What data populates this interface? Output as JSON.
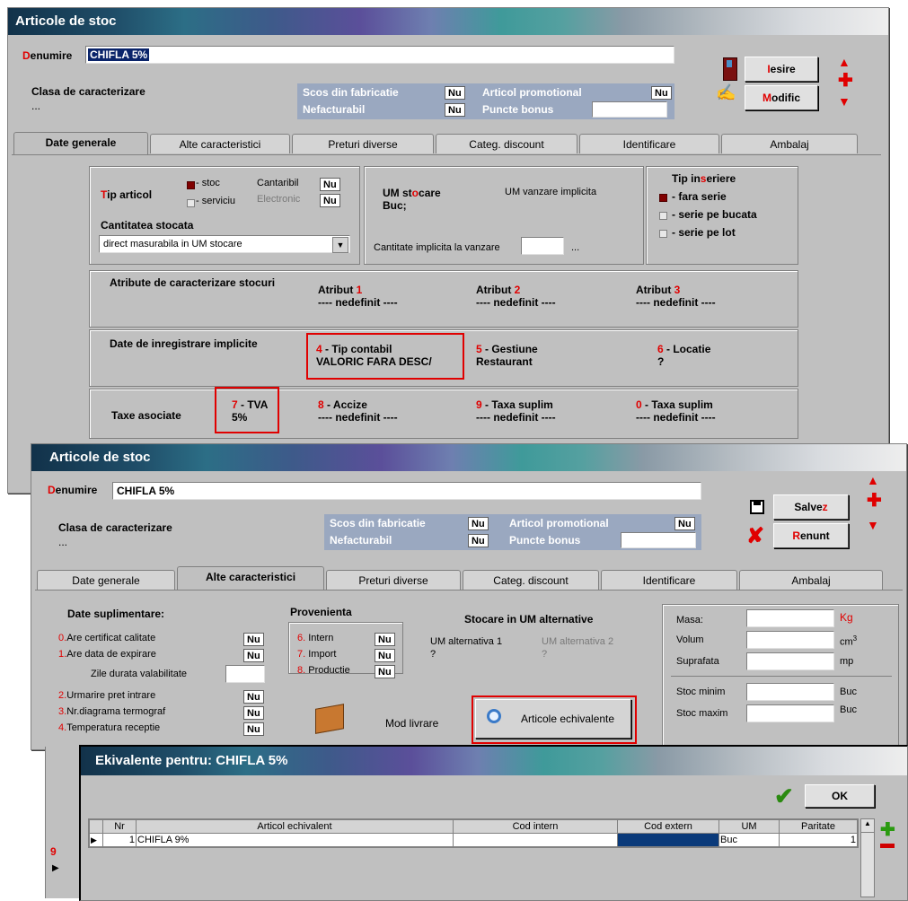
{
  "w1": {
    "title": "Articole de stoc",
    "denumire_label_first": "D",
    "denumire_label_rest": "enumire",
    "denumire_value": "CHIFLA 5%",
    "clasa_label_first": "Cl",
    "clasa_label_rest": "asa de caracterizare",
    "clasa_value": "...",
    "scos_label": "Scos din fabricatie",
    "scos_value": "Nu",
    "nefacturabil_label": "Nefacturabil",
    "nefacturabil_value": "Nu",
    "promo_label": "Articol promotional",
    "promo_value": "Nu",
    "bonus_label": "Puncte bonus",
    "btn_iesire_a": "I",
    "btn_iesire_b": "esire",
    "btn_modific_a": "M",
    "btn_modific_b": "odific",
    "tabs": [
      "Date generale",
      "Alte caracteristici",
      "Preturi diverse",
      "Categ. discount",
      "Identificare",
      "Ambalaj"
    ],
    "tip_articol_a": "T",
    "tip_articol_b": "ip articol",
    "stoc": "- stoc",
    "serviciu": "- serviciu",
    "cantaribil": "Cantaribil",
    "cantaribil_value": "Nu",
    "electronic": "Electronic",
    "electronic_value": "Nu",
    "cant_stocata": "Cantitatea stocata",
    "cant_stocata_value": "direct masurabila in UM stocare",
    "um_stocare_a": "UM st",
    "um_stocare_b": "o",
    "um_stocare_c": "care",
    "um_stocare_value": "Buc;",
    "um_vanzare": "UM vanzare implicita",
    "cant_vanzare": "Cantitate implicita la vanzare",
    "ellipsis": "...",
    "tip_inseriere_a": "Tip in",
    "tip_inseriere_b": "s",
    "tip_inseriere_c": "eriere",
    "fara_serie": "- fara serie",
    "serie_bucata": "- serie pe bucata",
    "serie_lot": "- serie pe lot",
    "atribute": "Atribute de caracterizare stocuri",
    "atribut1_a": "Atribut ",
    "atribut1_b": "1",
    "atribut2_b": "2",
    "atribut3_b": "3",
    "nedefinit": "---- nedefinit ----",
    "date_inreg": "Date de inregistrare implicite",
    "tip_contabil_a": "4",
    "tip_contabil_b": " - Tip contabil",
    "tip_contabil_value": "VALORIC FARA DESC/",
    "gestiune_a": "5",
    "gestiune_b": " - Gestiune",
    "gestiune_value": "Restaurant",
    "locatie_a": "6",
    "locatie_b": " - Locatie",
    "locatie_value": "?",
    "taxe": "Taxe asociate",
    "tva_a": "7",
    "tva_b": " - TVA",
    "tva_value": "5%",
    "accize_a": "8",
    "accize_b": " - Accize",
    "taxa9_a": "9",
    "taxa9_b": " - Taxa suplim",
    "taxa0_a": "0",
    "taxa0_b": " - Taxa suplim"
  },
  "w2": {
    "title": "Articole de stoc",
    "denumire_value": "CHIFLA 5%",
    "clasa_value": "...",
    "btn_salvez_a": "Salve",
    "btn_salvez_b": "z",
    "btn_renunt_a": "R",
    "btn_renunt_b": "enunt",
    "date_supl": "Date suplimentare:",
    "supl_items": [
      {
        "k": "0.",
        "t": "Are certificat calitate",
        "v": "Nu"
      },
      {
        "k": "1.",
        "t": "Are data de expirare",
        "v": "Nu"
      },
      {
        "k": "",
        "t": "Zile durata valabilitate",
        "v": ""
      },
      {
        "k": "2.",
        "t": "Urmarire pret intrare",
        "v": "Nu"
      },
      {
        "k": "3.",
        "t": "Nr.diagrama termograf",
        "v": "Nu"
      },
      {
        "k": "4.",
        "t": "Temperatura receptie",
        "v": "Nu"
      }
    ],
    "provenienta": "Provenienta",
    "prov_items": [
      {
        "k": "6.",
        "t": " Intern",
        "v": "Nu"
      },
      {
        "k": "7.",
        "t": " Import",
        "v": "Nu"
      },
      {
        "k": "8.",
        "t": " Productie",
        "v": "Nu"
      }
    ],
    "stocare_um_alt": "Stocare in UM alternative",
    "um_alt1": "UM alternativa 1",
    "um_alt1_value": "?",
    "um_alt2": "UM alternativa 2",
    "um_alt2_value": "?",
    "masa": "Masa:",
    "kg": "Kg",
    "volum": "Volum",
    "cm3": "cm",
    "cm3_sup": "3",
    "suprafata": "Suprafata",
    "mp": "mp",
    "stoc_minim": "Stoc minim",
    "stoc_maxim": "Stoc maxim",
    "buc": "Buc",
    "mod_livrare": "Mod livrare",
    "art_echiv": "Articole echivalente"
  },
  "w3": {
    "title": "Ekivalente pentru: CHIFLA 5%",
    "ok": "OK",
    "row_marker": "9",
    "columns": [
      "Nr",
      "Articol echivalent",
      "Cod intern",
      "Cod extern",
      "UM",
      "Paritate"
    ],
    "rows": [
      {
        "nr": "1",
        "articol": "CHIFLA 9%",
        "cod_intern": "",
        "cod_extern": "",
        "um": "Buc",
        "paritate": "1"
      }
    ]
  }
}
